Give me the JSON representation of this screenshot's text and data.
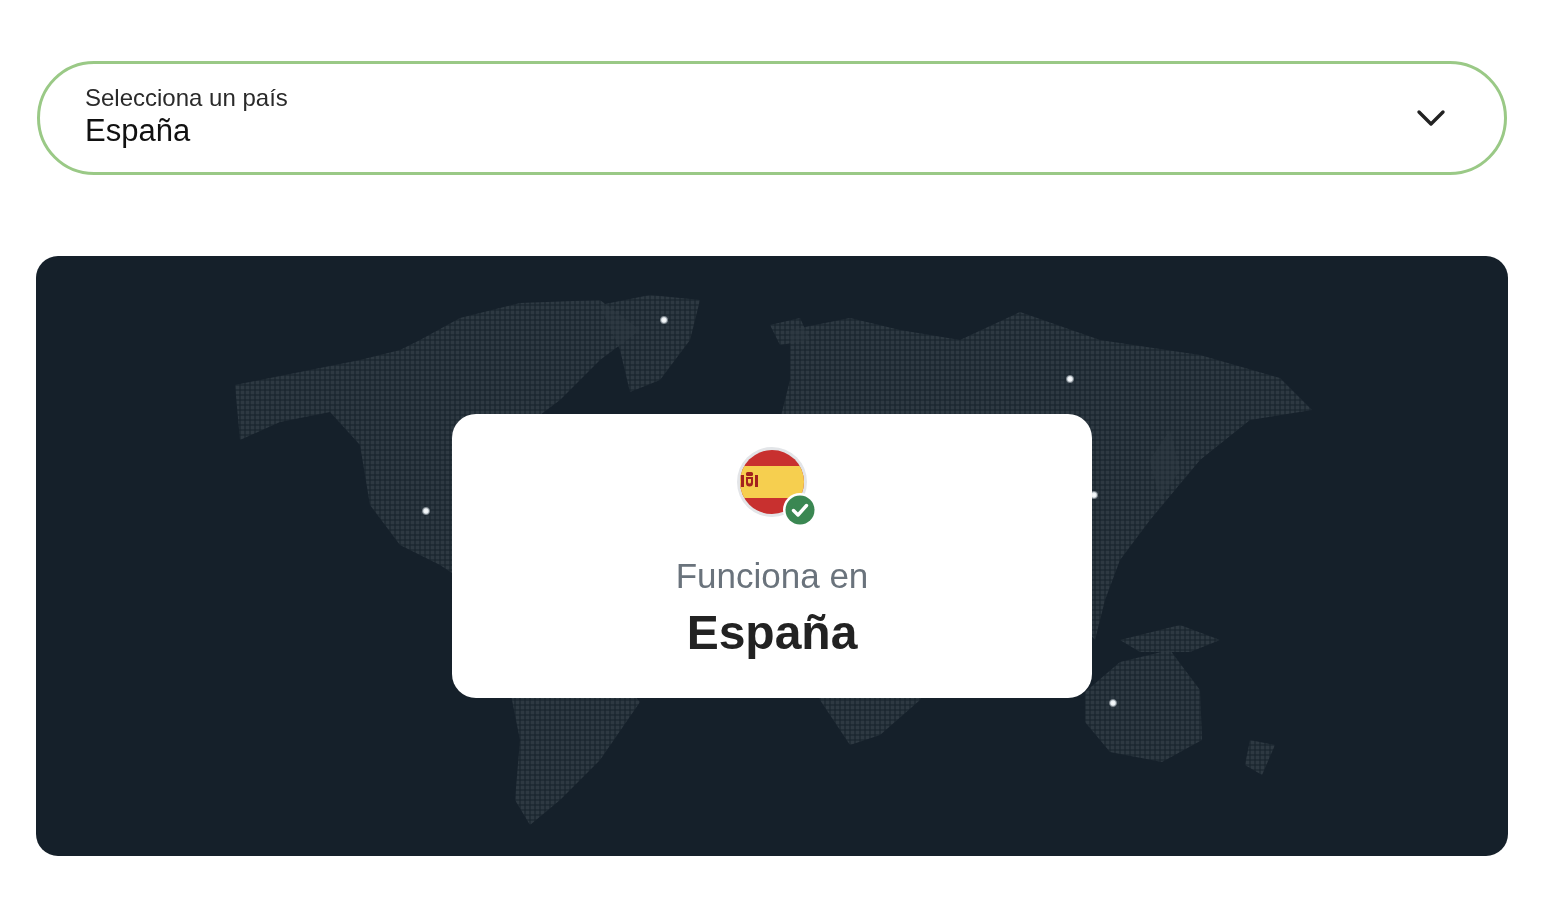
{
  "country_select": {
    "label": "Selecciona un país",
    "value": "España",
    "expanded": false
  },
  "coverage_card": {
    "caption": "Funciona en",
    "country": "España",
    "verified": true
  }
}
